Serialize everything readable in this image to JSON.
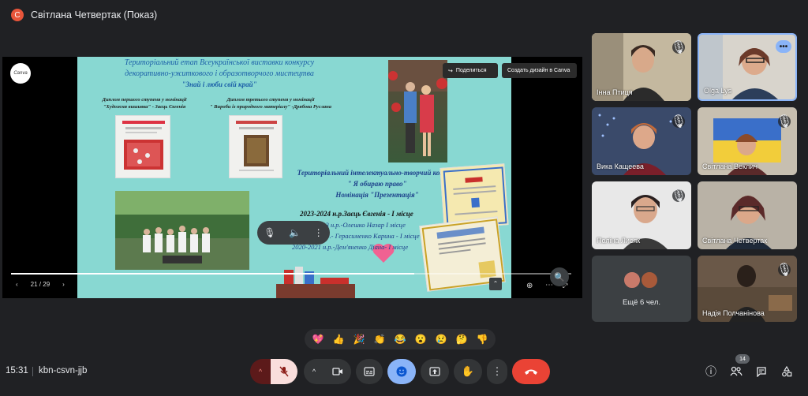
{
  "presenter": {
    "initial": "С",
    "title": "Світлана Четвертак (Показ)"
  },
  "slide": {
    "logo": "Canva",
    "share_label": "Поделиться",
    "create_label": "Создать дизайн в Canva",
    "title_lines": [
      "Територіальний етап Всеукраїнської виставки конкурсу",
      "декоративно-ужиткового і образотворчого мистецтва",
      "\"Знай і люби свій край\""
    ],
    "diploma1": [
      "Диплом першого ступеня у номінації",
      "\"Художня вишивка\" - Заєць Євгенія"
    ],
    "diploma2": [
      "Диплом третього ступеня у номінації",
      "\" Вироби із природного матеріалу\" -Дрябова Руслана"
    ],
    "contest_lines": [
      "Територіальний інтелектуально-творчий конкурс",
      "\" Я обираю право\"",
      "Номінація \"Презентація\""
    ],
    "results": [
      "2023-2024 н.р.Заєць Євгенія - І місце",
      "2022-2023 н.р.-Олешко Назар І місце",
      "2021-2022 н.р.- Герасименко Карина - І місце",
      "2020-2021 н.р.-Дем'яненко Діана- І місце"
    ],
    "page_indicator": "21 / 29"
  },
  "participants": [
    {
      "name": "Інна Птиця"
    },
    {
      "name": "Olga Lys"
    },
    {
      "name": "Вика Кащеева"
    },
    {
      "name": "Світлана Веклич"
    },
    {
      "name": "Поліна Лисяк"
    },
    {
      "name": "Світлана Четвертак"
    },
    {
      "name": "Ещё 6 чел."
    },
    {
      "name": "Надія Полчанінова"
    }
  ],
  "reactions": [
    "💖",
    "👍",
    "🎉",
    "👏",
    "😂",
    "😮",
    "😢",
    "🤔",
    "👎"
  ],
  "footer": {
    "time": "15:31",
    "meeting_code": "kbn-csvn-jjb",
    "participants_count": "14"
  },
  "colors": {
    "end_call": "#ea4335",
    "active": "#8ab4f8",
    "muted_bg": "#f9dedc",
    "slide_bg": "#88d8d2"
  }
}
